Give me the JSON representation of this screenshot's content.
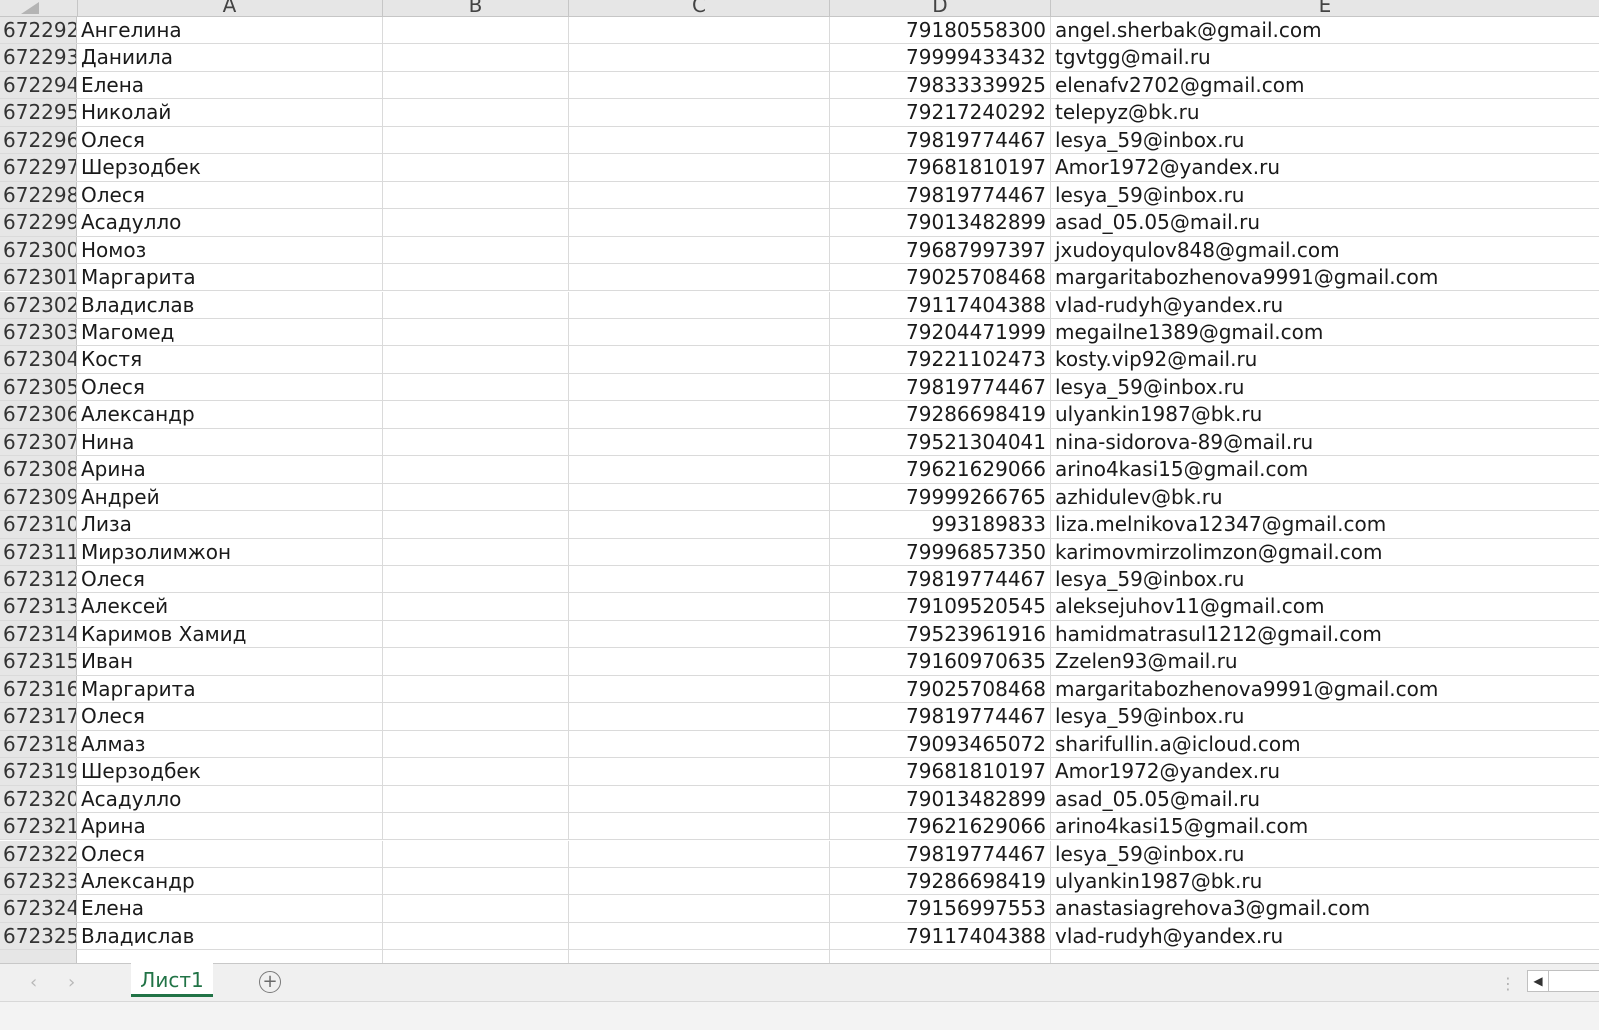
{
  "columns": [
    "A",
    "B",
    "C",
    "D",
    "E"
  ],
  "rows": [
    {
      "num": "672292",
      "name": "Ангелина",
      "phone": "79180558300",
      "email": "angel.sherbak@gmail.com"
    },
    {
      "num": "672293",
      "name": "Даниила",
      "phone": "79999433432",
      "email": "tgvtgg@mail.ru"
    },
    {
      "num": "672294",
      "name": "Елена",
      "phone": "79833339925",
      "email": "elenafv2702@gmail.com"
    },
    {
      "num": "672295",
      "name": "Николай",
      "phone": "79217240292",
      "email": "telepyz@bk.ru"
    },
    {
      "num": "672296",
      "name": "Олеся",
      "phone": "79819774467",
      "email": "lesya_59@inbox.ru"
    },
    {
      "num": "672297",
      "name": "Шерзодбек",
      "phone": "79681810197",
      "email": "Amor1972@yandex.ru"
    },
    {
      "num": "672298",
      "name": "Олеся",
      "phone": "79819774467",
      "email": "lesya_59@inbox.ru"
    },
    {
      "num": "672299",
      "name": "Асадулло",
      "phone": "79013482899",
      "email": "asad_05.05@mail.ru"
    },
    {
      "num": "672300",
      "name": "Номоз",
      "phone": "79687997397",
      "email": "jxudoyqulov848@gmail.com"
    },
    {
      "num": "672301",
      "name": "Маргарита",
      "phone": "79025708468",
      "email": "margaritabozhenova9991@gmail.com"
    },
    {
      "num": "672302",
      "name": "Владислав",
      "phone": "79117404388",
      "email": "vlad-rudyh@yandex.ru"
    },
    {
      "num": "672303",
      "name": "Магомед",
      "phone": "79204471999",
      "email": "megailne1389@gmail.com"
    },
    {
      "num": "672304",
      "name": "Костя",
      "phone": "79221102473",
      "email": "kosty.vip92@mail.ru"
    },
    {
      "num": "672305",
      "name": "Олеся",
      "phone": "79819774467",
      "email": "lesya_59@inbox.ru"
    },
    {
      "num": "672306",
      "name": "Александр",
      "phone": "79286698419",
      "email": "ulyankin1987@bk.ru"
    },
    {
      "num": "672307",
      "name": "Нина",
      "phone": "79521304041",
      "email": "nina-sidorova-89@mail.ru"
    },
    {
      "num": "672308",
      "name": "Арина",
      "phone": "79621629066",
      "email": "arino4kasi15@gmail.com"
    },
    {
      "num": "672309",
      "name": "Андрей",
      "phone": "79999266765",
      "email": "azhidulev@bk.ru"
    },
    {
      "num": "672310",
      "name": "Лиза",
      "phone": "993189833",
      "email": "liza.melnikova12347@gmail.com"
    },
    {
      "num": "672311",
      "name": "Мирзолимжон",
      "phone": "79996857350",
      "email": "karimovmirzolimzon@gmail.com"
    },
    {
      "num": "672312",
      "name": "Олеся",
      "phone": "79819774467",
      "email": "lesya_59@inbox.ru"
    },
    {
      "num": "672313",
      "name": "Алексей",
      "phone": "79109520545",
      "email": "aleksejuhov11@gmail.com"
    },
    {
      "num": "672314",
      "name": "Каримов Хамид",
      "phone": "79523961916",
      "email": "hamidmatrasul1212@gmail.com"
    },
    {
      "num": "672315",
      "name": "Иван",
      "phone": "79160970635",
      "email": "Zzelen93@mail.ru"
    },
    {
      "num": "672316",
      "name": "Маргарита",
      "phone": "79025708468",
      "email": "margaritabozhenova9991@gmail.com"
    },
    {
      "num": "672317",
      "name": "Олеся",
      "phone": "79819774467",
      "email": "lesya_59@inbox.ru"
    },
    {
      "num": "672318",
      "name": "Алмаз",
      "phone": "79093465072",
      "email": "sharifullin.a@icloud.com"
    },
    {
      "num": "672319",
      "name": "Шерзодбек",
      "phone": "79681810197",
      "email": "Amor1972@yandex.ru"
    },
    {
      "num": "672320",
      "name": "Асадулло",
      "phone": "79013482899",
      "email": "asad_05.05@mail.ru"
    },
    {
      "num": "672321",
      "name": "Арина",
      "phone": "79621629066",
      "email": "arino4kasi15@gmail.com"
    },
    {
      "num": "672322",
      "name": "Олеся",
      "phone": "79819774467",
      "email": "lesya_59@inbox.ru"
    },
    {
      "num": "672323",
      "name": "Александр",
      "phone": "79286698419",
      "email": "ulyankin1987@bk.ru"
    },
    {
      "num": "672324",
      "name": "Елена",
      "phone": "79156997553",
      "email": "anastasiagrehova3@gmail.com"
    },
    {
      "num": "672325",
      "name": "Владислав",
      "phone": "79117404388",
      "email": "vlad-rudyh@yandex.ru"
    }
  ],
  "tabs": {
    "active": "Лист1",
    "add_icon": "plus-circle-icon",
    "prev_icon": "chevron-left-icon",
    "next_icon": "chevron-right-icon"
  },
  "colors": {
    "accent": "#217346",
    "header_bg": "#e6e6e6",
    "gridline": "#dadada"
  }
}
